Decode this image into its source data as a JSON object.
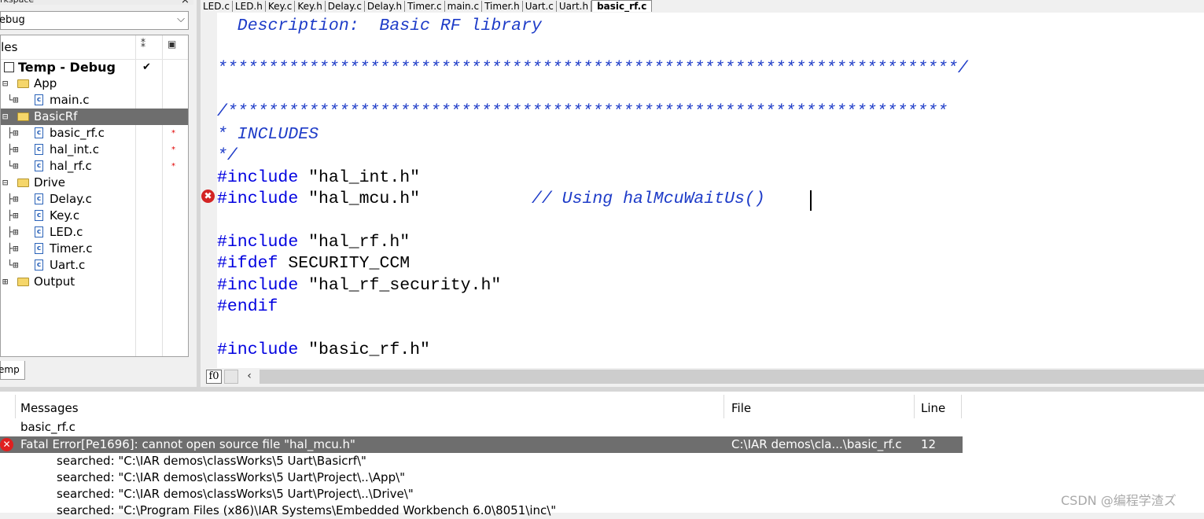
{
  "workspace": {
    "title": "rkspace",
    "config": "ebug",
    "files_header": "iles",
    "project_tab": "emp",
    "tree": [
      {
        "label": "Temp - Debug",
        "kind": "project",
        "check": "✔"
      },
      {
        "label": "App",
        "kind": "folder"
      },
      {
        "label": "main.c",
        "kind": "file"
      },
      {
        "label": "BasicRf",
        "kind": "folder",
        "selected": true
      },
      {
        "label": "basic_rf.c",
        "kind": "file",
        "modified": "*"
      },
      {
        "label": "hal_int.c",
        "kind": "file",
        "modified": "*"
      },
      {
        "label": "hal_rf.c",
        "kind": "file",
        "modified": "*"
      },
      {
        "label": "Drive",
        "kind": "folder"
      },
      {
        "label": "Delay.c",
        "kind": "file"
      },
      {
        "label": "Key.c",
        "kind": "file"
      },
      {
        "label": "LED.c",
        "kind": "file"
      },
      {
        "label": "Timer.c",
        "kind": "file"
      },
      {
        "label": "Uart.c",
        "kind": "file"
      },
      {
        "label": "Output",
        "kind": "folder"
      }
    ]
  },
  "editor": {
    "tabs": [
      "LED.c",
      "LED.h",
      "Key.c",
      "Key.h",
      "Delay.c",
      "Delay.h",
      "Timer.c",
      "main.c",
      "Timer.h",
      "Uart.c",
      "Uart.h",
      "basic_rf.c"
    ],
    "active_tab": "basic_rf.c",
    "lines": {
      "l1": "  Description:  Basic RF library",
      "l2": "*************************************************************************/",
      "l3": "/***********************************************************************",
      "l4": "* INCLUDES",
      "l5": "*/",
      "l6_kw": "#include",
      "l6_str": " \"hal_int.h\"",
      "l7_kw": "#include",
      "l7_str": " \"hal_mcu.h\"",
      "l7_cm": "           // Using halMcuWaitUs()",
      "l8_kw": "#include",
      "l8_str": " \"hal_rf.h\"",
      "l9_kw": "#ifdef",
      "l9_str": " SECURITY_CCM",
      "l10_kw": "#include",
      "l10_str": " \"hal_rf_security.h\"",
      "l11_kw": "#endif",
      "l12_kw": "#include",
      "l12_str": " \"basic_rf.h\""
    },
    "fo_button": "f0",
    "error_marker": "✖"
  },
  "messages": {
    "col_messages": "Messages",
    "col_file": "File",
    "col_line": "Line",
    "group": "basic_rf.c",
    "error": {
      "text": "Fatal Error[Pe1696]: cannot open source file \"hal_mcu.h\"",
      "file": "C:\\IAR demos\\cla...\\basic_rf.c",
      "line": "12"
    },
    "searched": [
      "searched: \"C:\\IAR demos\\classWorks\\5 Uart\\Basicrf\\\"",
      "searched: \"C:\\IAR demos\\classWorks\\5 Uart\\Project\\..\\App\\\"",
      "searched: \"C:\\IAR demos\\classWorks\\5 Uart\\Project\\..\\Drive\\\"",
      "searched: \"C:\\Program Files (x86)\\IAR Systems\\Embedded Workbench 6.0\\8051\\inc\\\""
    ]
  },
  "watermark": "CSDN @编程学渣ズ"
}
